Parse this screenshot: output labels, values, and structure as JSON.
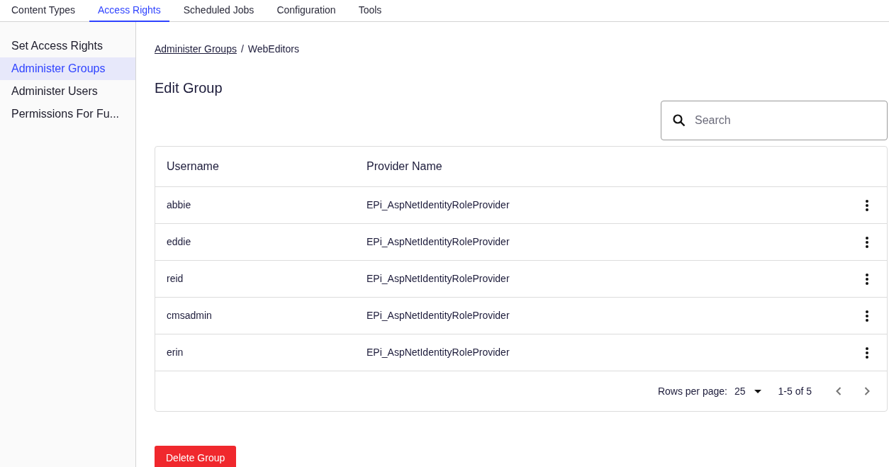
{
  "tabs": [
    {
      "label": "Content Types",
      "selected": false
    },
    {
      "label": "Access Rights",
      "selected": true
    },
    {
      "label": "Scheduled Jobs",
      "selected": false
    },
    {
      "label": "Configuration",
      "selected": false
    },
    {
      "label": "Tools",
      "selected": false
    }
  ],
  "sidebar": {
    "items": [
      {
        "label": "Set Access Rights",
        "selected": false
      },
      {
        "label": "Administer Groups",
        "selected": true
      },
      {
        "label": "Administer Users",
        "selected": false
      },
      {
        "label": "Permissions For Fu...",
        "selected": false
      }
    ]
  },
  "breadcrumb": {
    "link": "Administer Groups",
    "separator": "/",
    "current": "WebEditors"
  },
  "heading": "Edit Group",
  "search": {
    "placeholder": "Search"
  },
  "table": {
    "columns": [
      "Username",
      "Provider Name"
    ],
    "rows": [
      {
        "username": "abbie",
        "provider": "EPi_AspNetIdentityRoleProvider"
      },
      {
        "username": "eddie",
        "provider": "EPi_AspNetIdentityRoleProvider"
      },
      {
        "username": "reid",
        "provider": "EPi_AspNetIdentityRoleProvider"
      },
      {
        "username": "cmsadmin",
        "provider": "EPi_AspNetIdentityRoleProvider"
      },
      {
        "username": "erin",
        "provider": "EPi_AspNetIdentityRoleProvider"
      }
    ]
  },
  "pagination": {
    "rows_per_page_label": "Rows per page:",
    "rows_per_page": "25",
    "range": "1-5 of 5",
    "previous_disabled": true,
    "next_disabled": true
  },
  "delete_button": "Delete Group"
}
